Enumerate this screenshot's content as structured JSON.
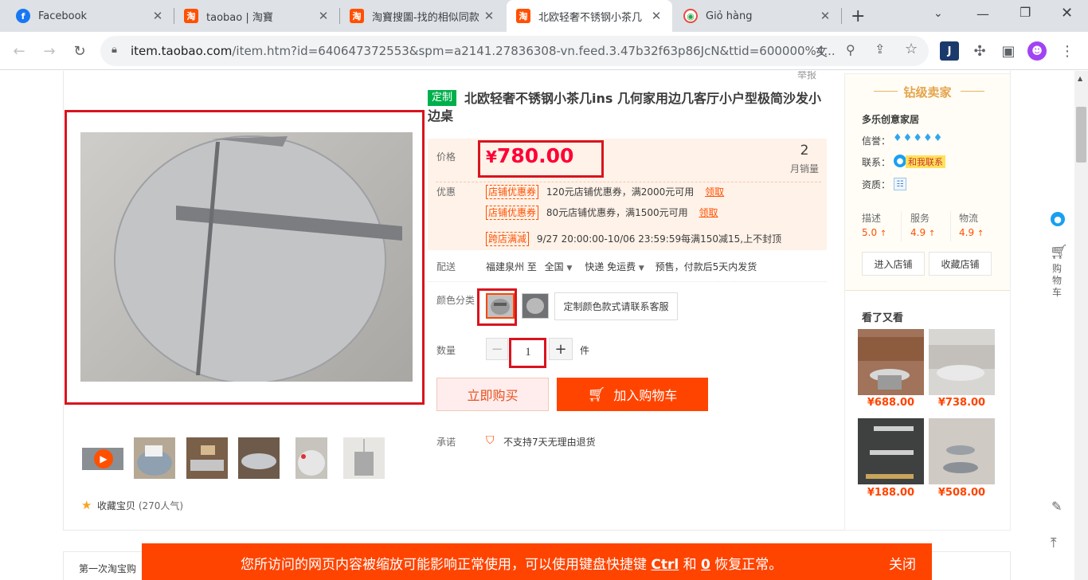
{
  "browser": {
    "tabs": [
      {
        "title": "Facebook",
        "icon": "facebook-icon"
      },
      {
        "title": "taobao | 淘寶",
        "icon": "taobao-icon"
      },
      {
        "title": "淘寶搜圖-找的相似同款",
        "icon": "taobao-icon"
      },
      {
        "title": "北欧轻奢不锈钢小茶几",
        "icon": "taobao-icon"
      },
      {
        "title": "Giỏ hàng",
        "icon": "cart-site-icon"
      }
    ],
    "url_host": "item.taobao.com",
    "url_path": "/item.htm?id=640647372553&spm=a2141.27836308-vn.feed.3.47b32f63p86JcN&ttid=600000%4..."
  },
  "page": {
    "report_link": "举报",
    "product": {
      "custom_tag": "定制",
      "title": "北欧轻奢不锈钢小茶几ins 几何家用边几客厅小户型极简沙发小边桌"
    },
    "price": {
      "label": "价格",
      "currency": "¥",
      "value": "780.00",
      "monthly_sales": "2",
      "monthly_sales_label": "月销量"
    },
    "promo": {
      "label": "优惠",
      "coupons": [
        {
          "tag": "店铺优惠券",
          "text": "120元店铺优惠券，满2000元可用",
          "action": "领取"
        },
        {
          "tag": "店铺优惠券",
          "text": "80元店铺优惠券，满1500元可用",
          "action": "领取"
        }
      ],
      "cross_store_tag": "跨店满减",
      "cross_store_text": "9/27 20:00:00-10/06 23:59:59每满150减15,上不封顶"
    },
    "delivery": {
      "label": "配送",
      "from": "福建泉州 至",
      "to": "全国",
      "shipping": "快递 免运费",
      "presale": "预售，付款后5天内发货"
    },
    "color": {
      "label": "颜色分类",
      "custom_option": "定制颜色款式请联系客服"
    },
    "quantity": {
      "label": "数量",
      "value": "1",
      "unit": "件",
      "minus": "−",
      "plus": "+"
    },
    "buttons": {
      "buy_now": "立即购买",
      "add_to_cart": "加入购物车"
    },
    "promise": {
      "label": "承诺",
      "text": "不支持7天无理由退货"
    },
    "favorite": {
      "text": "收藏宝贝",
      "count": "(270人气)"
    },
    "seller": {
      "level_title": "钻级卖家",
      "shop_name": "多乐创意家居",
      "reputation_label": "信誉：",
      "contact_label": "联系：",
      "contact_button": "和我联系",
      "qualification_label": "资质：",
      "ratings": [
        {
          "label": "描述",
          "value": "5.0"
        },
        {
          "label": "服务",
          "value": "4.9"
        },
        {
          "label": "物流",
          "value": "4.9"
        }
      ],
      "enter_shop": "进入店铺",
      "favorite_shop": "收藏店铺"
    },
    "recommend": {
      "title": "看了又看",
      "items": [
        {
          "price": "¥688.00"
        },
        {
          "price": "¥738.00"
        },
        {
          "price": "¥188.00"
        },
        {
          "price": "¥508.00"
        }
      ]
    },
    "side_tool": {
      "cart_label": "购物车"
    },
    "bottom_left_text": "第一次淘宝购",
    "notice": {
      "before": "您所访问的网页内容被缩放可能影响正常使用，可以使用键盘快捷键",
      "key1": "Ctrl",
      "and": "和",
      "key2": "0",
      "after": "恢复正常。",
      "close": "关闭"
    }
  },
  "colors": {
    "taobao_orange": "#ff4400",
    "price_red": "#ff0036",
    "highlight_red": "#d9141e"
  }
}
